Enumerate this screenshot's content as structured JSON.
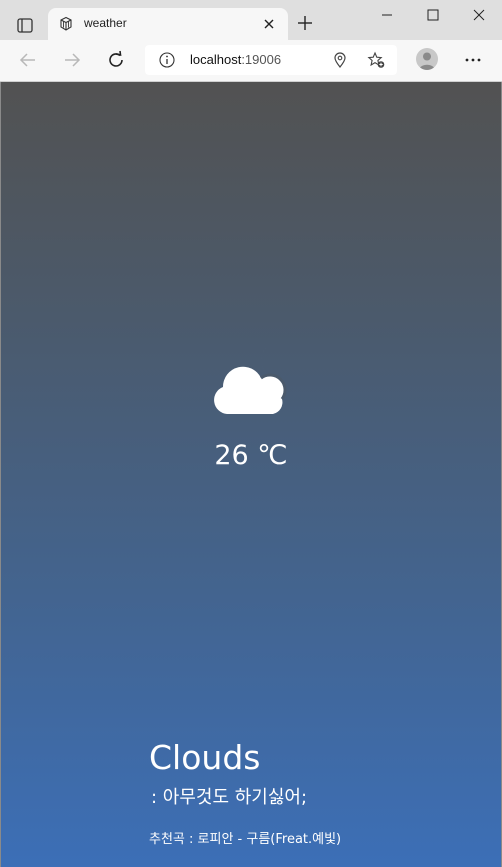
{
  "browser": {
    "tab": {
      "title": "weather",
      "close_label": "close-tab"
    },
    "address": {
      "host": "localhost",
      "port": ":19006"
    }
  },
  "weather": {
    "icon": "cloud-moon-icon",
    "temperature": "26 ℃",
    "condition": "Clouds",
    "mood": ": 아무것도 하기싫어;",
    "recommendation": "추천곡 : 로피안 - 구름(Freat.예빛)"
  },
  "colors": {
    "gradient_top": "#525252",
    "gradient_bottom": "#3c6fb7",
    "text": "#ffffff"
  }
}
